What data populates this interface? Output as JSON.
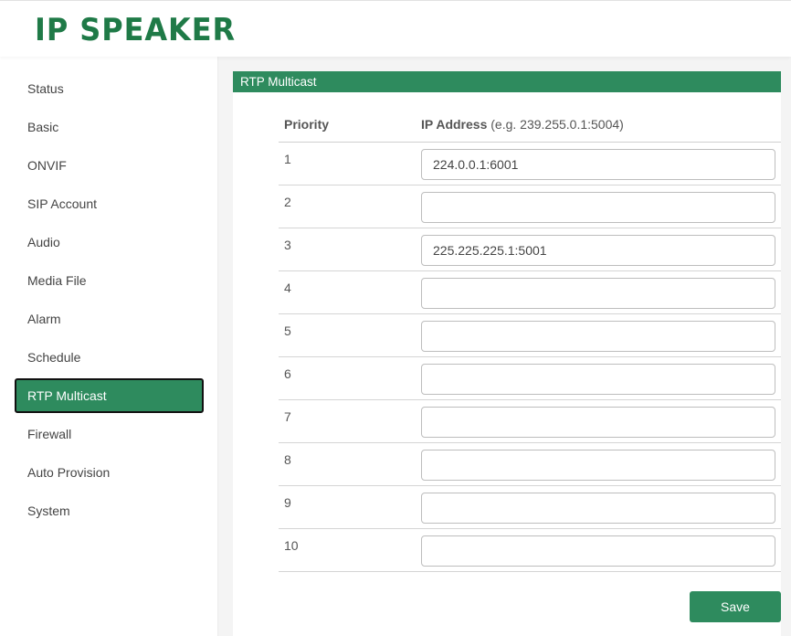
{
  "app": {
    "logo_text": "IP SPEAKER",
    "brand_color": "#1f7a47",
    "accent_color": "#2e8b5e"
  },
  "sidebar": {
    "items": [
      {
        "label": "Status",
        "active": false
      },
      {
        "label": "Basic",
        "active": false
      },
      {
        "label": "ONVIF",
        "active": false
      },
      {
        "label": "SIP Account",
        "active": false
      },
      {
        "label": "Audio",
        "active": false
      },
      {
        "label": "Media File",
        "active": false
      },
      {
        "label": "Alarm",
        "active": false
      },
      {
        "label": "Schedule",
        "active": false
      },
      {
        "label": "RTP Multicast",
        "active": true
      },
      {
        "label": "Firewall",
        "active": false
      },
      {
        "label": "Auto Provision",
        "active": false
      },
      {
        "label": "System",
        "active": false
      }
    ]
  },
  "main": {
    "section_title": "RTP Multicast",
    "table": {
      "header_priority": "Priority",
      "header_ip": "IP Address",
      "header_ip_hint": "(e.g. 239.255.0.1:5004)",
      "rows": [
        {
          "priority": "1",
          "ip": "224.0.0.1:6001"
        },
        {
          "priority": "2",
          "ip": ""
        },
        {
          "priority": "3",
          "ip": "225.225.225.1:5001"
        },
        {
          "priority": "4",
          "ip": ""
        },
        {
          "priority": "5",
          "ip": ""
        },
        {
          "priority": "6",
          "ip": ""
        },
        {
          "priority": "7",
          "ip": ""
        },
        {
          "priority": "8",
          "ip": ""
        },
        {
          "priority": "9",
          "ip": ""
        },
        {
          "priority": "10",
          "ip": ""
        }
      ]
    },
    "save_label": "Save"
  }
}
